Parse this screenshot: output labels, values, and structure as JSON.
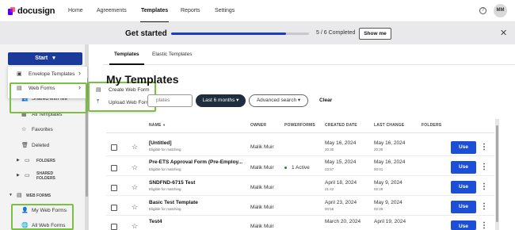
{
  "topnav": {
    "logo": "docusign",
    "links": [
      "Home",
      "Agreements",
      "Templates",
      "Reports",
      "Settings"
    ],
    "active": "Templates",
    "help_icon": "?",
    "avatar": "MM"
  },
  "get_started": {
    "title": "Get started",
    "progress": 0.8333,
    "count": "5 / 6 Completed",
    "button": "Show me",
    "close_icon": "✕"
  },
  "sidebar": {
    "start_label": "Start",
    "shared_with_me": "Shared with Me",
    "all_templates": "All Templates",
    "favorites": "Favorites",
    "deleted": "Deleted",
    "folders": "FOLDERS",
    "shared_folders": "SHARED FOLDERS",
    "web_forms_section": "WEB FORMS",
    "my_web_forms": "My Web Forms",
    "all_web_forms": "All Web Forms"
  },
  "start_menu": {
    "items": [
      "Envelope Templates",
      "Web Forms"
    ],
    "submenu": [
      "Create Web Form",
      "Upload Web Form"
    ]
  },
  "tabs": [
    "Templates",
    "Elastic Templates"
  ],
  "page_title": "My Templates",
  "filters": {
    "search_placeholder": "plates",
    "date_filter": "Last 6 months ▾",
    "advanced": "Advanced search ▾",
    "clear": "Clear"
  },
  "table": {
    "headers": [
      "NAME",
      "OWNER",
      "POWERFORMS",
      "CREATED DATE",
      "LAST CHANGE",
      "FOLDERS"
    ],
    "sort_indicator": "▼",
    "rows": [
      {
        "name": "[Untitled]",
        "sub": "Eligible for matching",
        "owner": "Malik Muir",
        "powerforms": "",
        "created": "May 16, 2024",
        "created_time": "20:30",
        "changed": "May 16, 2024",
        "changed_time": "20:30",
        "action": "Use"
      },
      {
        "name": "Pre-ETS Approval Form (Pre-Employ...",
        "sub": "Eligible for matching",
        "owner": "Malik Muir",
        "powerforms": "1 Active",
        "created": "May 15, 2024",
        "created_time": "23:57",
        "changed": "May 16, 2024",
        "changed_time": "00:01",
        "action": "Use"
      },
      {
        "name": "SNDFND-6715 Test",
        "sub": "Eligible for matching",
        "owner": "Malik Muir",
        "powerforms": "",
        "created": "April 18, 2024",
        "created_time": "21:42",
        "changed": "May 9, 2024",
        "changed_time": "02:28",
        "action": "Use"
      },
      {
        "name": "Basic Test Template",
        "sub": "Eligible for matching",
        "owner": "Malik Muir",
        "powerforms": "",
        "created": "April 23, 2024",
        "created_time": "00:56",
        "changed": "May 9, 2024",
        "changed_time": "02:28",
        "action": "Use"
      },
      {
        "name": "Test4",
        "sub": "",
        "owner": "Malik Muir",
        "powerforms": "",
        "created": "March 20, 2024",
        "created_time": "",
        "changed": "April 19, 2024",
        "changed_time": "",
        "action": "Use"
      }
    ]
  },
  "colors": {
    "brand_blue": "#1b3a99",
    "use_button": "#1b4fd8",
    "progress": "#1b3cc9",
    "highlight": "#7ac143",
    "chip_dark": "#1f2d3d"
  },
  "icons": {
    "kebab": "⋮",
    "star": "☆",
    "chevron_right": "›",
    "caret_down": "▾"
  }
}
